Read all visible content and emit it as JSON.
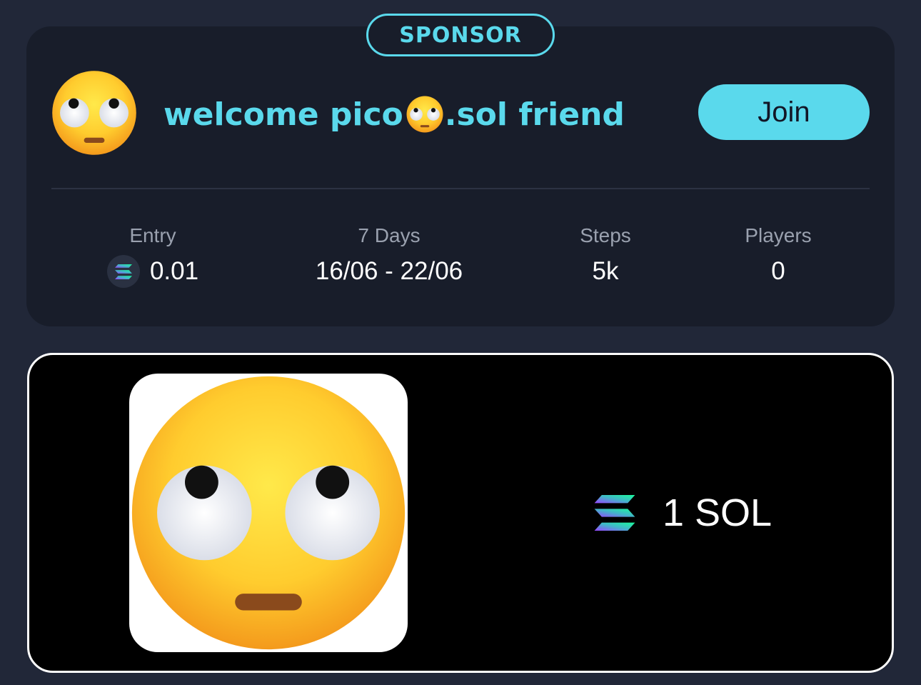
{
  "sponsor_badge": "SPONSOR",
  "header": {
    "avatar_icon": "face-with-rolling-eyes-emoji",
    "title_prefix": "welcome pico",
    "title_inline_icon": "face-with-rolling-eyes-emoji",
    "title_suffix": ".sol friend",
    "join_label": "Join"
  },
  "stats": {
    "entry": {
      "label": "Entry",
      "value": "0.01",
      "icon": "solana-icon"
    },
    "duration": {
      "label": "7 Days",
      "value": "16/06 - 22/06"
    },
    "steps": {
      "label": "Steps",
      "value": "5k"
    },
    "players": {
      "label": "Players",
      "value": "0"
    }
  },
  "prize": {
    "image_icon": "face-with-rolling-eyes-emoji",
    "amount": "1 SOL",
    "icon": "solana-icon"
  },
  "colors": {
    "background": "#212738",
    "card": "#181d2a",
    "accent": "#5ad9ec",
    "muted_text": "#9aa1af",
    "prize_card": "#000000"
  }
}
